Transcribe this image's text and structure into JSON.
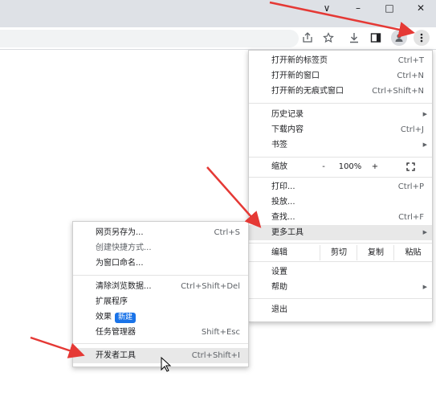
{
  "window_controls": {
    "dropdown": "∨",
    "minimize": "–",
    "maximize": "□",
    "close": "✕"
  },
  "toolbar_icons": [
    "share-icon",
    "star-icon",
    "download-icon",
    "side-panel-icon",
    "profile-icon",
    "kebab-menu-icon"
  ],
  "main_menu": {
    "new_tab": {
      "label": "打开新的标签页",
      "shortcut": "Ctrl+T"
    },
    "new_window": {
      "label": "打开新的窗口",
      "shortcut": "Ctrl+N"
    },
    "new_incognito": {
      "label": "打开新的无痕式窗口",
      "shortcut": "Ctrl+Shift+N"
    },
    "history": {
      "label": "历史记录"
    },
    "downloads": {
      "label": "下载内容",
      "shortcut": "Ctrl+J"
    },
    "bookmarks": {
      "label": "书签"
    },
    "zoom": {
      "label": "缩放",
      "minus": "-",
      "value": "100%",
      "plus": "+",
      "fullscreen": "⛶"
    },
    "print": {
      "label": "打印...",
      "shortcut": "Ctrl+P"
    },
    "cast": {
      "label": "投放..."
    },
    "find": {
      "label": "查找...",
      "shortcut": "Ctrl+F"
    },
    "more_tools": {
      "label": "更多工具"
    },
    "edit": {
      "label": "编辑",
      "cut": "剪切",
      "copy": "复制",
      "paste": "粘贴"
    },
    "settings": {
      "label": "设置"
    },
    "help": {
      "label": "帮助"
    },
    "exit": {
      "label": "退出"
    }
  },
  "sub_menu": {
    "save_page": {
      "label": "网页另存为...",
      "shortcut": "Ctrl+S"
    },
    "create_shortcut": {
      "label": "创建快捷方式..."
    },
    "name_window": {
      "label": "为窗口命名..."
    },
    "clear_data": {
      "label": "清除浏览数据...",
      "shortcut": "Ctrl+Shift+Del"
    },
    "extensions": {
      "label": "扩展程序"
    },
    "performance": {
      "label": "效果",
      "badge": "新建"
    },
    "task_manager": {
      "label": "任务管理器",
      "shortcut": "Shift+Esc"
    },
    "dev_tools": {
      "label": "开发者工具",
      "shortcut": "Ctrl+Shift+I"
    }
  },
  "colors": {
    "arrow": "#e53935",
    "badge": "#1a73e8",
    "titlebar": "#dee1e6",
    "highlight": "#e8e8e8"
  }
}
